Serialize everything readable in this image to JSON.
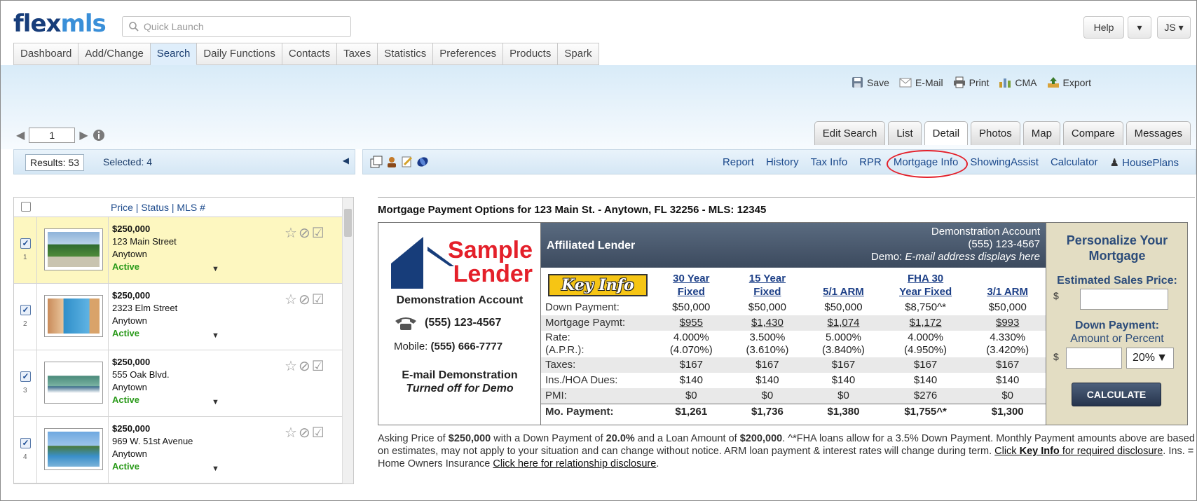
{
  "header": {
    "logo_part1": "flex",
    "logo_part2": "mls",
    "quick_launch_placeholder": "Quick Launch",
    "help_label": "Help",
    "user_initials": "JS"
  },
  "menu": [
    "Dashboard",
    "Add/Change",
    "Search",
    "Daily Functions",
    "Contacts",
    "Taxes",
    "Statistics",
    "Preferences",
    "Products",
    "Spark"
  ],
  "menu_active": "Search",
  "actions": [
    "Save",
    "E-Mail",
    "Print",
    "CMA",
    "Export"
  ],
  "pager": {
    "page": "1"
  },
  "view_tabs": [
    "Edit Search",
    "List",
    "Detail",
    "Photos",
    "Map",
    "Compare",
    "Messages"
  ],
  "view_active": "Detail",
  "results": {
    "results_label": "Results: 53",
    "selected_label": "Selected: 4"
  },
  "sublinks": [
    "Report",
    "History",
    "Tax Info",
    "RPR",
    "Mortgage Info",
    "ShowingAssist",
    "Calculator",
    "HousePlans"
  ],
  "list_header": "Price | Status | MLS #",
  "listings": [
    {
      "num": "1",
      "price": "$250,000",
      "address": "123 Main Street",
      "city": "Anytown",
      "status": "Active"
    },
    {
      "num": "2",
      "price": "$250,000",
      "address": "2323 Elm Street",
      "city": "Anytown",
      "status": "Active"
    },
    {
      "num": "3",
      "price": "$250,000",
      "address": "555 Oak Blvd.",
      "city": "Anytown",
      "status": "Active"
    },
    {
      "num": "4",
      "price": "$250,000",
      "address": "969 W. 51st Avenue",
      "city": "Anytown",
      "status": "Active"
    }
  ],
  "mortgage": {
    "title": "Mortgage Payment Options for 123 Main St. - Anytown, FL 32256 - MLS: 12345",
    "lender": {
      "logo_line1": "Sample",
      "logo_line2": "Lender",
      "account": "Demonstration Account",
      "phone": "(555) 123-4567",
      "mobile_label": "Mobile:",
      "mobile": "(555) 666-7777",
      "email_line1": "E-mail Demonstration",
      "email_line2": "Turned off for Demo"
    },
    "header": {
      "affiliated": "Affiliated Lender",
      "demo_line1": "Demonstration Account",
      "demo_line2": "(555) 123-4567",
      "demo_line3_prefix": "Demo: ",
      "demo_line3_italic": "E-mail address displays here"
    },
    "key_info": "Key Info",
    "columns": [
      {
        "l1": "30 Year",
        "l2": "Fixed"
      },
      {
        "l1": "15 Year",
        "l2": "Fixed"
      },
      {
        "l1": "",
        "l2": "5/1 ARM"
      },
      {
        "l1": "FHA 30",
        "l2": "Year Fixed"
      },
      {
        "l1": "",
        "l2": "3/1 ARM"
      }
    ],
    "rows": {
      "down": {
        "label": "Down Payment:",
        "v": [
          "$50,000",
          "$50,000",
          "$50,000",
          "$8,750^*",
          "$50,000"
        ]
      },
      "payment": {
        "label": "Mortgage Paymt:",
        "v": [
          "$955",
          "$1,430",
          "$1,074",
          "$1,172",
          "$993"
        ]
      },
      "rate": {
        "label1": "Rate:",
        "label2": "(A.P.R.):",
        "v": [
          "4.000%",
          "3.500%",
          "5.000%",
          "4.000%",
          "4.330%"
        ],
        "apr": [
          "(4.070%)",
          "(3.610%)",
          "(3.840%)",
          "(4.950%)",
          "(3.420%)"
        ]
      },
      "taxes": {
        "label": "Taxes:",
        "v": [
          "$167",
          "$167",
          "$167",
          "$167",
          "$167"
        ]
      },
      "ins": {
        "label": "Ins./HOA Dues:",
        "v": [
          "$140",
          "$140",
          "$140",
          "$140",
          "$140"
        ]
      },
      "pmi": {
        "label": "PMI:",
        "v": [
          "$0",
          "$0",
          "$0",
          "$276",
          "$0"
        ]
      },
      "total": {
        "label": "Mo. Payment:",
        "v": [
          "$1,261",
          "$1,736",
          "$1,380",
          "$1,755^*",
          "$1,300"
        ]
      }
    },
    "personalize": {
      "title_line1": "Personalize Your",
      "title_line2": "Mortgage",
      "sales_label": "Estimated Sales Price:",
      "currency": "$",
      "down_label": "Down Payment:",
      "down_sub": "Amount or Percent",
      "percent": "20%",
      "calculate": "CALCULATE"
    }
  },
  "disclaimer": {
    "t1": "Asking Price of ",
    "asking": "$250,000",
    "t2": " with a Down Payment of ",
    "down_pct": "20.0%",
    "t3": " and a Loan Amount of ",
    "loan": "$200,000",
    "t4": ". ^*FHA loans allow for a 3.5% Down Payment. Monthly Payment amounts above are based on estimates, may not apply to your situation and can change without notice. ARM loan payment & interest rates will change during term. ",
    "link1_a": "Click ",
    "link1_b": "Key Info",
    "link1_c": " for required disclosure",
    "t5": ". Ins. = Home Owners Insurance ",
    "link2": "Click here for relationship disclosure",
    "t6": "."
  },
  "colors": {
    "accent_blue": "#1c4a8c",
    "active_green": "#2a9a1a",
    "lender_red": "#e4202a",
    "highlight_row": "#fdf7c0"
  }
}
